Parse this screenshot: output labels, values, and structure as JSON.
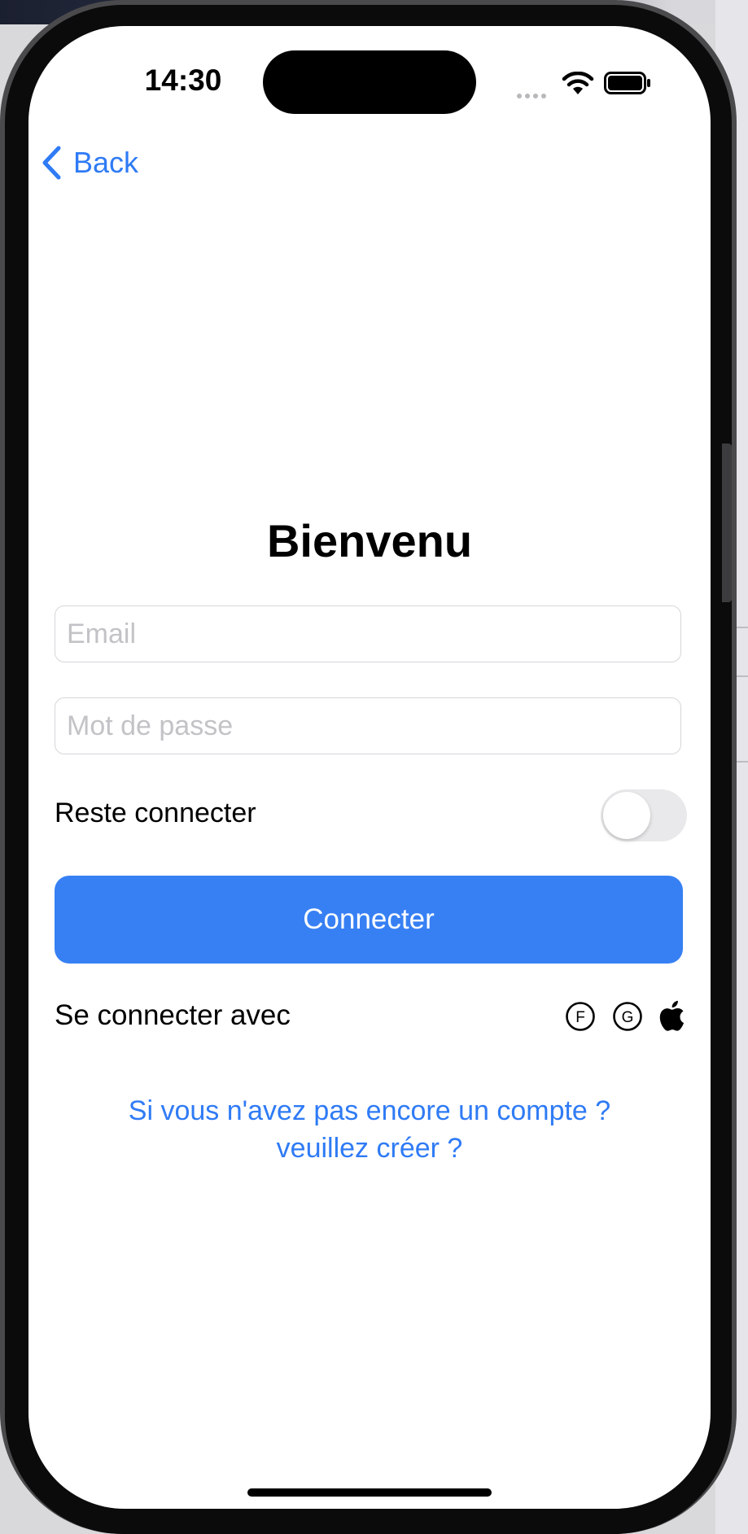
{
  "status_bar": {
    "time": "14:30"
  },
  "nav": {
    "back_label": "Back"
  },
  "login": {
    "title": "Bienvenu",
    "email_placeholder": "Email",
    "email_value": "",
    "password_placeholder": "Mot de passe",
    "password_value": "",
    "remember_label": "Reste connecter",
    "remember_enabled": false,
    "connect_label": "Connecter",
    "social_label": "Se connecter avec",
    "social_icons": [
      "facebook-icon",
      "google-icon",
      "apple-icon"
    ],
    "facebook_letter": "F",
    "google_letter": "G",
    "signup_line1": "Si vous n'avez pas encore un compte ?",
    "signup_line2": "veuillez créer ?"
  },
  "colors": {
    "accent": "#3780f4",
    "link": "#2f7bf5",
    "toggle_off": "#e9e9eb",
    "field_border": "#d6d6da",
    "placeholder": "#c3c3c7"
  }
}
